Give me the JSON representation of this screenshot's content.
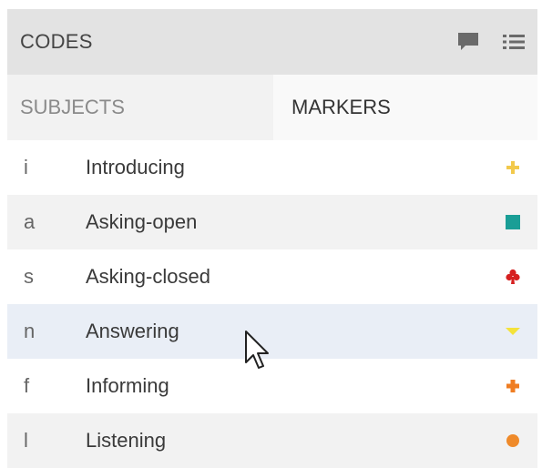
{
  "header": {
    "title": "CODES",
    "icons": [
      "comment-icon",
      "list-icon"
    ]
  },
  "tabs": [
    {
      "label": "SUBJECTS",
      "active": false
    },
    {
      "label": "MARKERS",
      "active": true
    }
  ],
  "codes": [
    {
      "key": "i",
      "label": "Introducing",
      "marker": "plus",
      "color": "#f2c94c"
    },
    {
      "key": "a",
      "label": "Asking-open",
      "marker": "square",
      "color": "#1a9e96"
    },
    {
      "key": "s",
      "label": "Asking-closed",
      "marker": "club",
      "color": "#d62020"
    },
    {
      "key": "n",
      "label": "Answering",
      "marker": "chevron-down",
      "color": "#f4e23a"
    },
    {
      "key": "f",
      "label": "Informing",
      "marker": "plus",
      "color": "#ef7d22"
    },
    {
      "key": "l",
      "label": "Listening",
      "marker": "circle",
      "color": "#ef8a2a"
    }
  ]
}
